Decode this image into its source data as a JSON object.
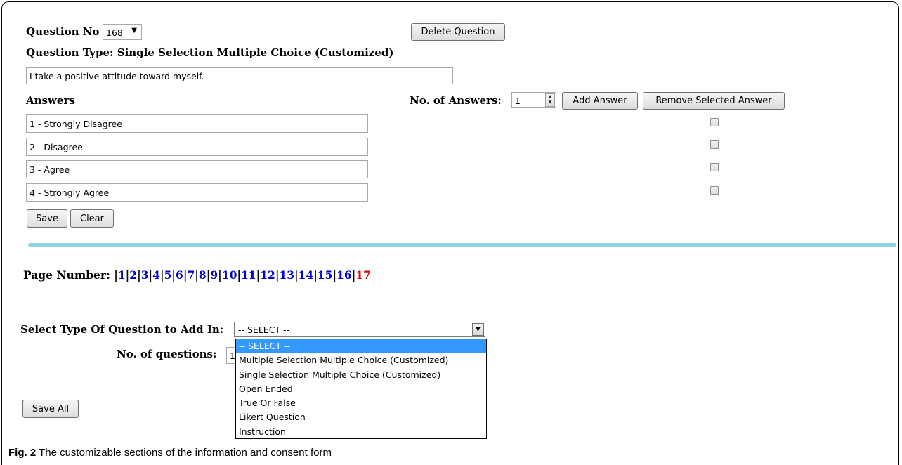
{
  "question_header": {
    "question_no_label": "Question No",
    "question_no_value": "168",
    "delete_button": "Delete Question",
    "question_type_label": "Question Type: Single Selection Multiple Choice (Customized)",
    "question_text": "I take a positive attitude toward myself."
  },
  "answers_section": {
    "answers_label": "Answers",
    "num_answers_label": "No. of Answers:",
    "num_answers_value": "1",
    "add_answer_button": "Add Answer",
    "remove_answer_button": "Remove Selected Answer",
    "answers": [
      {
        "text": "1 - Strongly Disagree",
        "selected": false
      },
      {
        "text": "2 - Disagree",
        "selected": false
      },
      {
        "text": "3 - Agree",
        "selected": false
      },
      {
        "text": "4 - Strongly Agree",
        "selected": false
      }
    ],
    "save_button": "Save",
    "clear_button": "Clear"
  },
  "pagination": {
    "label": "Page Number:",
    "pages": [
      "1",
      "2",
      "3",
      "4",
      "5",
      "6",
      "7",
      "8",
      "9",
      "10",
      "11",
      "12",
      "13",
      "14",
      "15",
      "16"
    ],
    "current_page": "17"
  },
  "add_question": {
    "select_type_label": "Select Type Of Question to Add In:",
    "selected_value": "-- SELECT --",
    "options": [
      "-- SELECT --",
      "Multiple Selection Multiple Choice (Customized)",
      "Single Selection Multiple Choice (Customized)",
      "Open Ended",
      "True Or False",
      "Likert Question",
      "Instruction"
    ],
    "num_questions_label": "No. of questions:",
    "num_questions_value": "1",
    "save_all_button": "Save All"
  },
  "caption": {
    "fig_label": "Fig. 2",
    "text": " The customizable sections of the information and consent form"
  },
  "colors": {
    "divider": "#8fd3df",
    "link": "#0000cc",
    "current_page": "#e00000",
    "dropdown_highlight": "#3399ff"
  },
  "icons": {
    "dropdown_arrow": "chevron-down-icon",
    "spinner": "spinner-arrows-icon"
  }
}
